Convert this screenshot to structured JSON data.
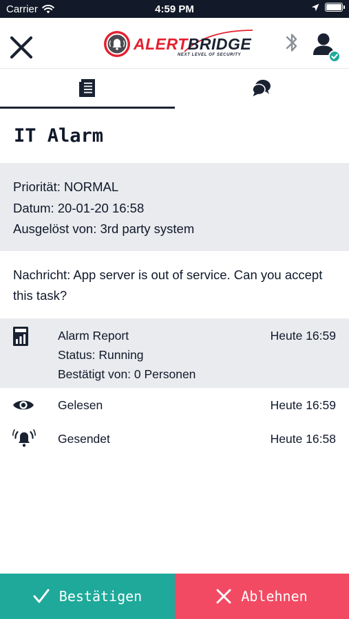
{
  "status_bar": {
    "carrier": "Carrier",
    "time": "4:59 PM"
  },
  "header": {
    "logo": {
      "word_red": "ALERT",
      "word_dark": "BRIDGE",
      "tagline": "NEXT LEVEL OF SECURITY"
    },
    "icons": [
      "close-icon",
      "bluetooth-icon",
      "user-verified-icon"
    ]
  },
  "tabs": [
    {
      "name": "details",
      "icon": "document-icon",
      "active": true
    },
    {
      "name": "chat",
      "icon": "chat-bubbles-icon",
      "active": false
    }
  ],
  "alarm": {
    "title": "IT Alarm",
    "priority": "Priorität: NORMAL",
    "date": "Datum: 20-01-20 16:58",
    "triggered_by": "Ausgelöst von: 3rd party system",
    "message": "Nachricht: App server is out of service. Can you accept this task?"
  },
  "history": [
    {
      "icon": "report-icon",
      "lines": [
        "Alarm Report",
        "Status: Running",
        "Bestätigt von: 0 Personen"
      ],
      "time": "Heute 16:59"
    },
    {
      "icon": "eye-icon",
      "lines": [
        "Gelesen"
      ],
      "time": "Heute 16:59"
    },
    {
      "icon": "alarm-bell-icon",
      "lines": [
        "Gesendet"
      ],
      "time": "Heute 16:58"
    }
  ],
  "actions": {
    "accept_label": "Bestätigen",
    "decline_label": "Ablehnen"
  },
  "colors": {
    "accept": "#1ea99a",
    "decline": "#f24a63",
    "status_bar": "#121a29",
    "brand_red": "#e4202e",
    "verified_badge": "#1ea99a",
    "panel_background": "#e9ebee"
  }
}
